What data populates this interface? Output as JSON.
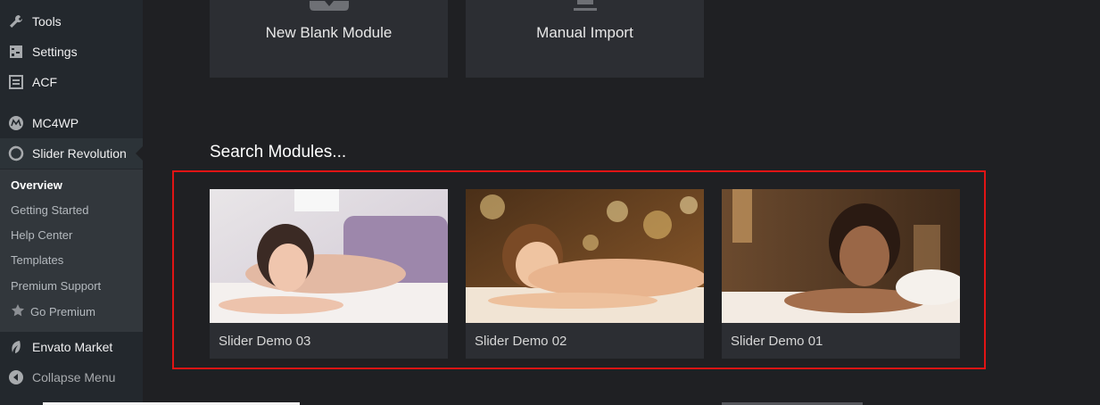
{
  "sidebar": {
    "items": [
      {
        "label": "Tools",
        "icon": "wrench-icon"
      },
      {
        "label": "Settings",
        "icon": "settings-icon"
      },
      {
        "label": "ACF",
        "icon": "acf-icon"
      },
      {
        "label": "MC4WP",
        "icon": "mc4wp-icon"
      },
      {
        "label": "Slider Revolution",
        "icon": "slider-revolution-icon"
      },
      {
        "label": "Envato Market",
        "icon": "leaf-icon"
      },
      {
        "label": "Collapse Menu",
        "icon": "collapse-icon"
      }
    ],
    "submenu": [
      {
        "label": "Overview"
      },
      {
        "label": "Getting Started"
      },
      {
        "label": "Help Center"
      },
      {
        "label": "Templates"
      },
      {
        "label": "Premium Support"
      },
      {
        "label": "Go Premium",
        "icon": "star-icon"
      }
    ]
  },
  "tiles": [
    {
      "label": "New Blank Module"
    },
    {
      "label": "Manual Import"
    }
  ],
  "search_title": "Search Modules...",
  "modules": [
    {
      "label": "Slider Demo 03"
    },
    {
      "label": "Slider Demo 02"
    },
    {
      "label": "Slider Demo 01"
    }
  ],
  "colors": {
    "highlight": "#e01414",
    "sidebar_bg": "#23282d",
    "main_bg": "#1f2023",
    "card_bg": "#2c2e33"
  }
}
